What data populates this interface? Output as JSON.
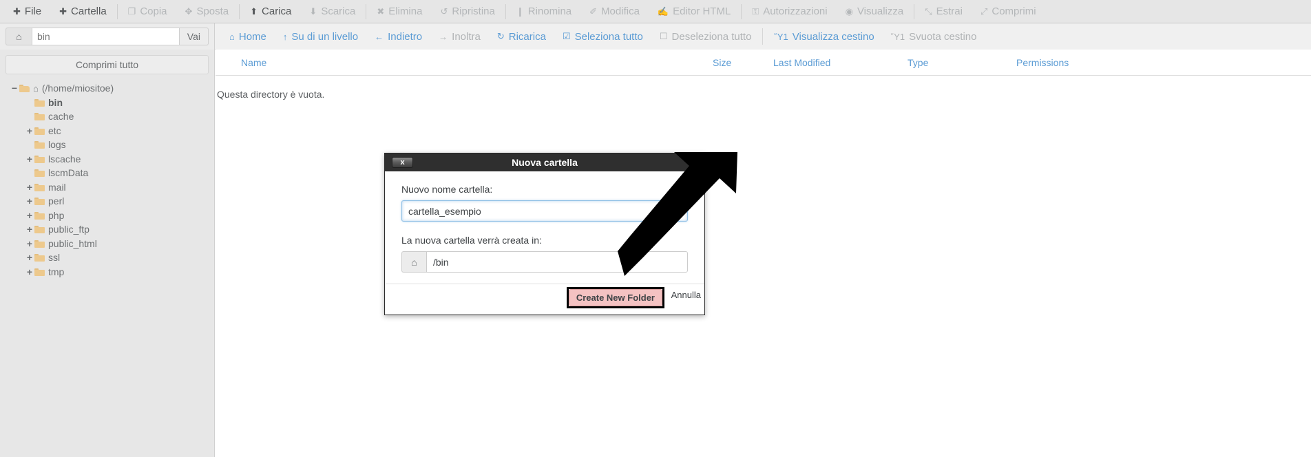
{
  "toolbar": {
    "items": [
      {
        "label": "File",
        "icon": "plus-icon",
        "enabled": true
      },
      {
        "label": "Cartella",
        "icon": "plus-icon",
        "enabled": true
      },
      {
        "label": "Copia",
        "icon": "copy-icon",
        "enabled": false
      },
      {
        "label": "Sposta",
        "icon": "move-icon",
        "enabled": false
      },
      {
        "label": "Carica",
        "icon": "upload-icon",
        "enabled": true
      },
      {
        "label": "Scarica",
        "icon": "download-icon",
        "enabled": false
      },
      {
        "label": "Elimina",
        "icon": "delete-x-icon",
        "enabled": false
      },
      {
        "label": "Ripristina",
        "icon": "restore-icon",
        "enabled": false
      },
      {
        "label": "Rinomina",
        "icon": "file-icon",
        "enabled": false
      },
      {
        "label": "Modifica",
        "icon": "pencil-icon",
        "enabled": false
      },
      {
        "label": "Editor HTML",
        "icon": "html-editor-icon",
        "enabled": false
      },
      {
        "label": "Autorizzazioni",
        "icon": "key-icon",
        "enabled": false
      },
      {
        "label": "Visualizza",
        "icon": "eye-icon",
        "enabled": false
      },
      {
        "label": "Estrai",
        "icon": "expand-arrows-icon",
        "enabled": false
      },
      {
        "label": "Comprimi",
        "icon": "compress-arrows-icon",
        "enabled": false
      }
    ]
  },
  "path_bar": {
    "home_icon": "home-icon",
    "value": "bin",
    "placeholder": "bin",
    "go_label": "Vai"
  },
  "nav": {
    "items": [
      {
        "label": "Home",
        "icon": "home-icon",
        "enabled": true
      },
      {
        "label": "Su di un livello",
        "icon": "arrow-up-icon",
        "enabled": true
      },
      {
        "label": "Indietro",
        "icon": "arrow-left-icon",
        "enabled": true
      },
      {
        "label": "Inoltra",
        "icon": "arrow-right-icon",
        "enabled": false
      },
      {
        "label": "Ricarica",
        "icon": "refresh-icon",
        "enabled": true
      },
      {
        "label": "Seleziona tutto",
        "icon": "checkbox-checked-icon",
        "enabled": true
      },
      {
        "label": "Deseleziona tutto",
        "icon": "checkbox-empty-icon",
        "enabled": false
      },
      {
        "label": "Visualizza cestino",
        "icon": "trash-icon",
        "enabled": true
      },
      {
        "label": "Svuota cestino",
        "icon": "trash-icon",
        "enabled": false
      }
    ]
  },
  "sidebar": {
    "collapse_label": "Comprimi tutto",
    "tree": [
      {
        "label": "(/home/miositoe)",
        "toggle": "−",
        "indent": 0,
        "icon": "folder-open-home-icon",
        "bold": false,
        "home": true
      },
      {
        "label": "bin",
        "toggle": "",
        "indent": 1,
        "icon": "folder-icon",
        "bold": true,
        "home": false
      },
      {
        "label": "cache",
        "toggle": "",
        "indent": 1,
        "icon": "folder-icon",
        "bold": false,
        "home": false
      },
      {
        "label": "etc",
        "toggle": "+",
        "indent": 1,
        "icon": "folder-icon",
        "bold": false,
        "home": false
      },
      {
        "label": "logs",
        "toggle": "",
        "indent": 1,
        "icon": "folder-icon",
        "bold": false,
        "home": false
      },
      {
        "label": "lscache",
        "toggle": "+",
        "indent": 1,
        "icon": "folder-icon",
        "bold": false,
        "home": false
      },
      {
        "label": "lscmData",
        "toggle": "",
        "indent": 1,
        "icon": "folder-icon",
        "bold": false,
        "home": false
      },
      {
        "label": "mail",
        "toggle": "+",
        "indent": 1,
        "icon": "folder-icon",
        "bold": false,
        "home": false
      },
      {
        "label": "perl",
        "toggle": "+",
        "indent": 1,
        "icon": "folder-icon",
        "bold": false,
        "home": false
      },
      {
        "label": "php",
        "toggle": "+",
        "indent": 1,
        "icon": "folder-icon",
        "bold": false,
        "home": false
      },
      {
        "label": "public_ftp",
        "toggle": "+",
        "indent": 1,
        "icon": "folder-icon",
        "bold": false,
        "home": false
      },
      {
        "label": "public_html",
        "toggle": "+",
        "indent": 1,
        "icon": "folder-icon",
        "bold": false,
        "home": false
      },
      {
        "label": "ssl",
        "toggle": "+",
        "indent": 1,
        "icon": "folder-icon",
        "bold": false,
        "home": false
      },
      {
        "label": "tmp",
        "toggle": "+",
        "indent": 1,
        "icon": "folder-icon",
        "bold": false,
        "home": false
      }
    ]
  },
  "file_list": {
    "columns": [
      "Name",
      "Size",
      "Last Modified",
      "Type",
      "Permissions"
    ],
    "empty_message": "Questa directory è vuota."
  },
  "modal": {
    "title": "Nuova cartella",
    "close_label": "x",
    "name_label": "Nuovo nome cartella:",
    "name_value": "cartella_esempio",
    "location_label": "La nuova cartella verrà creata in:",
    "location_icon": "home-icon",
    "location_value": "/bin",
    "create_label": "Create New Folder",
    "cancel_label": "Annulla"
  },
  "colors": {
    "accent_link": "#5a9bd4",
    "toolbar_bg": "#e6e6e6",
    "sidebar_bg": "#e7e7e7",
    "modal_header_bg": "#2f2f2f",
    "highlight_button_bg": "#f4c2c2",
    "annotation": "#000000",
    "folder": "#edc98d"
  }
}
